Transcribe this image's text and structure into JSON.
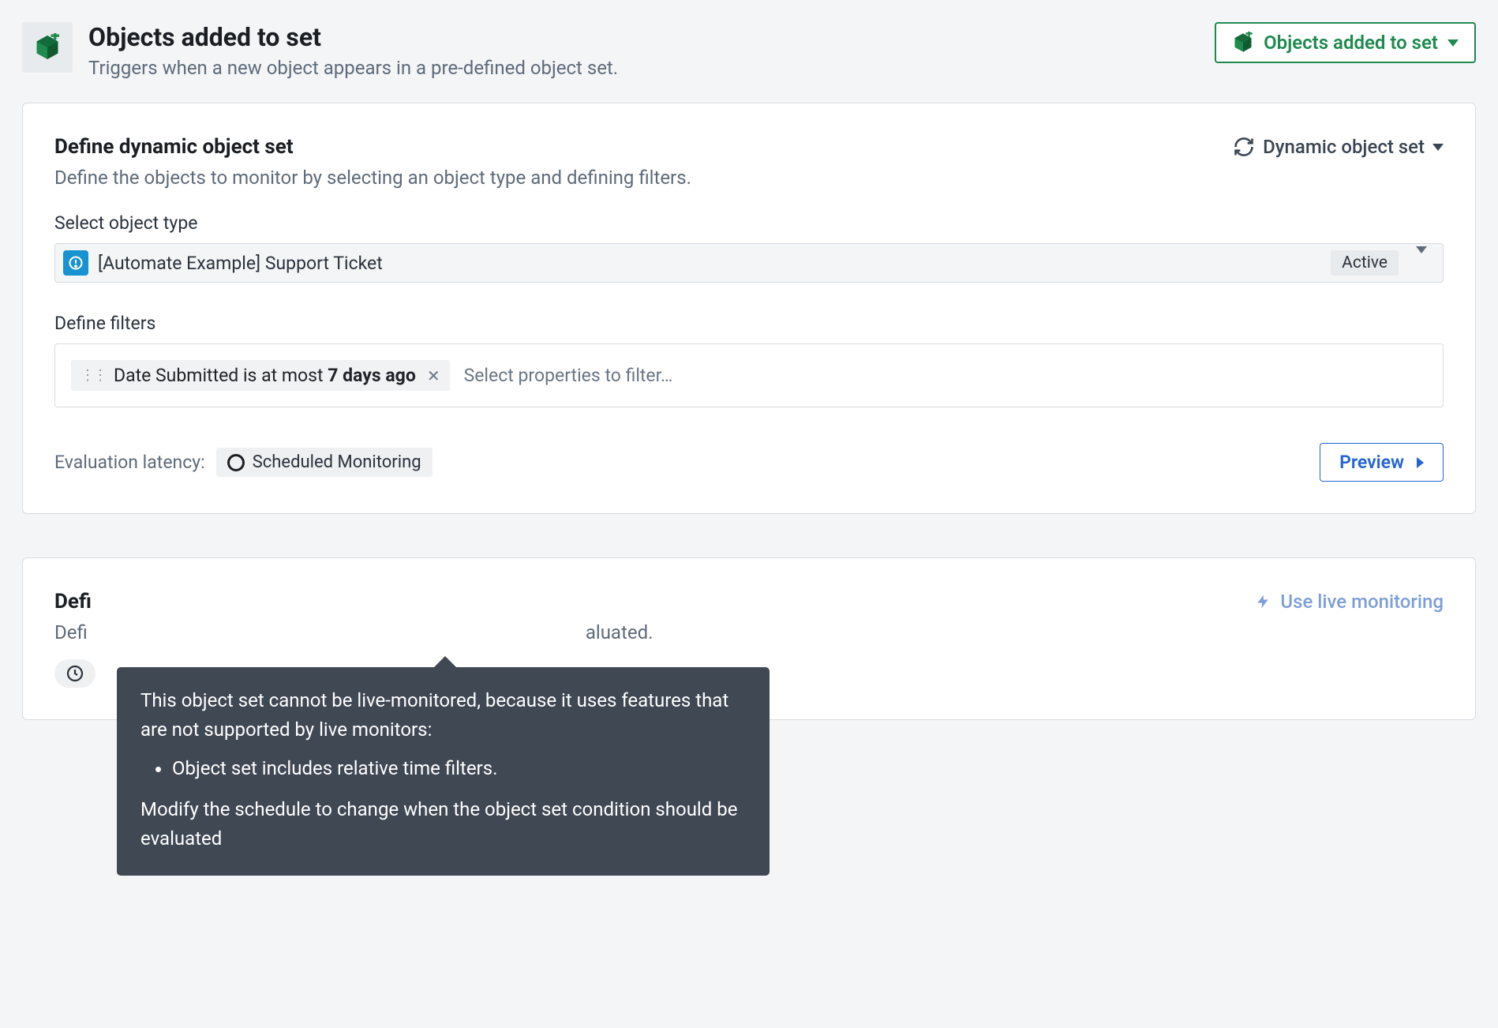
{
  "header": {
    "title": "Objects added to set",
    "subtitle": "Triggers when a new object appears in a pre-defined object set.",
    "dropdown_label": "Objects added to set"
  },
  "card": {
    "section_title": "Define dynamic object set",
    "section_dropdown_label": "Dynamic object set",
    "section_desc": "Define the objects to monitor by selecting an object type and defining filters.",
    "select_label": "Select object type",
    "object_type_name": "[Automate Example] Support Ticket",
    "object_status": "Active",
    "filters_label": "Define filters",
    "filter_chip_prefix": "Date Submitted is at most ",
    "filter_chip_bold": "7 days ago",
    "filter_placeholder": "Select properties to filter…",
    "eval_label": "Evaluation latency:",
    "eval_badge": "Scheduled Monitoring",
    "preview_label": "Preview"
  },
  "tooltip": {
    "intro": "This object set cannot be live-monitored, because it uses features that are not supported by live monitors:",
    "bullet1": "Object set includes relative time filters.",
    "outro": "Modify the schedule to change when the object set condition should be evaluated"
  },
  "card2": {
    "title_prefix": "Defi",
    "desc_prefix": "Defi",
    "desc_suffix": "aluated.",
    "live_label": "Use live monitoring"
  }
}
